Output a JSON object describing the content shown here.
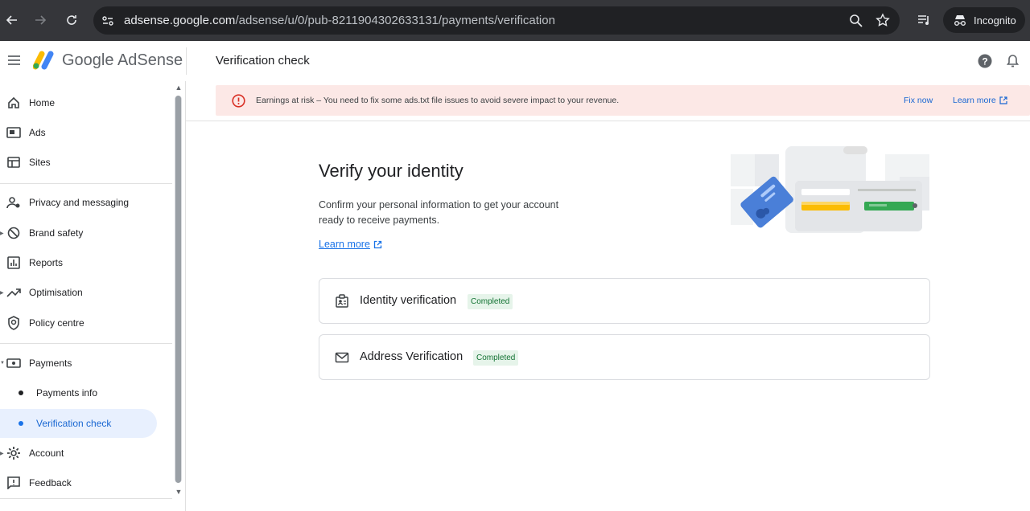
{
  "browser": {
    "url_host": "adsense.google.com",
    "url_path": "/adsense/u/0/pub-8211904302633131/payments/verification",
    "incognito_label": "Incognito"
  },
  "app": {
    "brand": "Google AdSense",
    "page_title": "Verification check"
  },
  "sidebar": {
    "items": [
      {
        "label": "Home",
        "icon": "home-icon"
      },
      {
        "label": "Ads",
        "icon": "ads-icon"
      },
      {
        "label": "Sites",
        "icon": "sites-icon"
      },
      {
        "label": "Privacy and messaging",
        "icon": "privacy-icon"
      },
      {
        "label": "Brand safety",
        "icon": "block-icon"
      },
      {
        "label": "Reports",
        "icon": "reports-icon"
      },
      {
        "label": "Optimisation",
        "icon": "trending-icon"
      },
      {
        "label": "Policy centre",
        "icon": "policy-shield-icon"
      },
      {
        "label": "Payments",
        "icon": "payments-icon"
      },
      {
        "label": "Payments info"
      },
      {
        "label": "Verification check"
      },
      {
        "label": "Account",
        "icon": "gear-icon"
      },
      {
        "label": "Feedback",
        "icon": "feedback-icon"
      }
    ]
  },
  "alert": {
    "message": "Earnings at risk – You need to fix some ads.txt file issues to avoid severe impact to your revenue.",
    "fix_label": "Fix now",
    "learn_label": "Learn more"
  },
  "main": {
    "heading": "Verify your identity",
    "description": "Confirm your personal information to get your account ready to receive payments.",
    "learn_more": "Learn more",
    "cards": [
      {
        "title": "Identity verification",
        "status": "Completed"
      },
      {
        "title": "Address Verification",
        "status": "Completed"
      }
    ]
  },
  "colors": {
    "accent": "#1a73e8",
    "alert_bg": "#fce8e6",
    "alert_icon": "#d93025",
    "success_bg": "#e6f4ea",
    "success_text": "#137333"
  }
}
